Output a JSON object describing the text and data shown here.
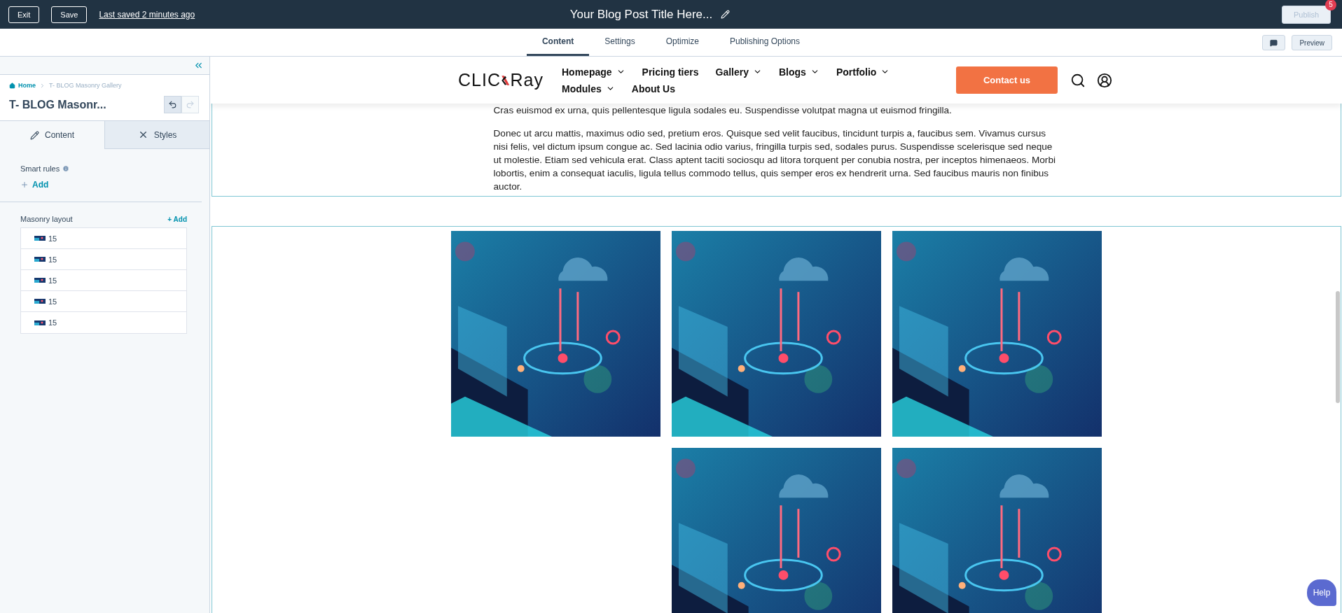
{
  "top_bar": {
    "buttons": [
      "Exit",
      "Save"
    ],
    "last_saved": "Last saved 2 minutes ago",
    "title": "Your Blog Post Title Here...",
    "publish": {
      "label": "Publish",
      "disabled": true
    },
    "badge": "5"
  },
  "tabs": [
    {
      "label": "Content",
      "selected": true
    },
    {
      "label": "Settings",
      "selected": false
    },
    {
      "label": "Optimize",
      "selected": false
    },
    {
      "label": "Publishing Options",
      "selected": false
    }
  ],
  "preview": "Preview",
  "sidebar": {
    "breadcrumb": [
      "Home",
      "T- BLOG Masonry Gallery"
    ],
    "title": "T- BLOG Masonr...",
    "history": [
      {
        "kind": "undo",
        "disabled": false
      },
      {
        "kind": "redo",
        "disabled": true
      }
    ],
    "tabs": [
      {
        "label": "Content",
        "kind": "content",
        "selected": true
      },
      {
        "label": "Styles",
        "kind": "styles",
        "selected": false
      }
    ],
    "smart_rules": {
      "label": "Smart rules",
      "add": "Add"
    },
    "masonry": {
      "label": "Masonry layout",
      "add": "+ Add",
      "items": [
        {
          "label": "15"
        },
        {
          "label": "15"
        },
        {
          "label": "15"
        },
        {
          "label": "15"
        },
        {
          "label": "15"
        }
      ]
    }
  },
  "site_header": {
    "logo": [
      "CLIC",
      "Ray"
    ],
    "nav": [
      {
        "label": "Homepage",
        "dropdown": true
      },
      {
        "label": "Pricing tiers",
        "dropdown": false
      },
      {
        "label": "Gallery",
        "dropdown": true
      },
      {
        "label": "Blogs",
        "dropdown": true
      },
      {
        "label": "Portfolio",
        "dropdown": true
      },
      {
        "label": "Modules",
        "dropdown": true
      },
      {
        "label": "About Us",
        "dropdown": false
      }
    ],
    "cta": "Contact us"
  },
  "content": {
    "paragraphs": [
      "Cras euismod ex urna, quis pellentesque ligula sodales eu. Suspendisse volutpat magna ut euismod fringilla.",
      "Donec ut arcu mattis, maximus odio sed, pretium eros. Quisque sed velit faucibus, tincidunt turpis a, faucibus sem. Vivamus cursus nisi felis, vel dictum ipsum congue ac. Sed lacinia odio varius, fringilla turpis sed, sodales purus. Suspendisse scelerisque sed neque ut molestie. Etiam sed vehicula erat. Class aptent taciti sociosqu ad litora torquent per conubia nostra, per inceptos himenaeos. Morbi lobortis, enim a consequat iaculis, ligula tellus commodo tellus, quis semper eros ex hendrerit urna. Sed faucibus mauris non finibus auctor."
    ]
  },
  "gallery": {
    "images": [
      {
        "kind": "picture"
      },
      {
        "kind": "picture"
      },
      {
        "kind": "picture"
      },
      {
        "kind": "empty"
      },
      {
        "kind": "picture"
      },
      {
        "kind": "picture"
      }
    ]
  },
  "help": "Help"
}
